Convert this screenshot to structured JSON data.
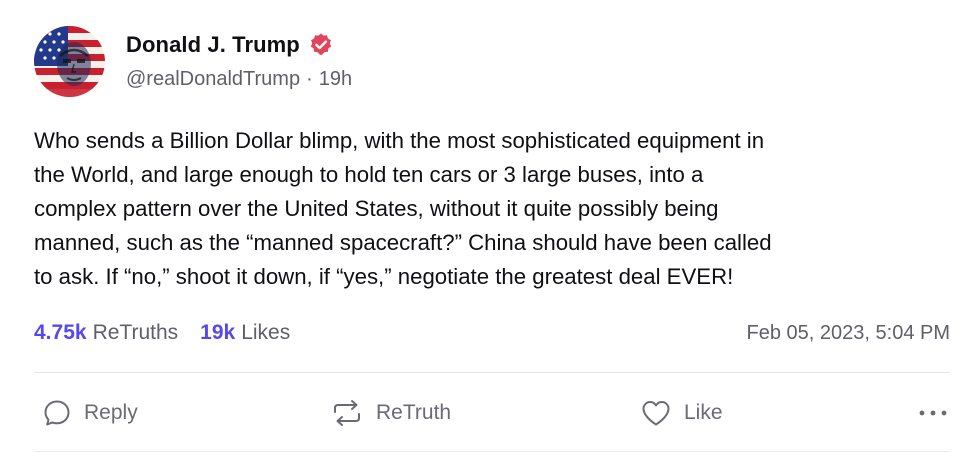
{
  "post": {
    "author": {
      "display_name": "Donald J. Trump",
      "handle": "@realDonaldTrump",
      "separator": "·",
      "time_ago": "19h",
      "verified": true,
      "avatar_icon": "flag-portrait-avatar"
    },
    "body_lines": [
      "Who sends a Billion Dollar blimp, with the most sophisticated equipment in",
      "the World, and large enough to hold ten cars or 3 large buses, into a",
      "complex pattern over the United States, without it quite possibly being",
      "manned, such as the “manned spacecraft?” China should have been called",
      "to ask. If “no,” shoot it down, if “yes,” negotiate the greatest deal EVER!"
    ],
    "stats": {
      "retruths_count": "4.75k",
      "retruths_label": "ReTruths",
      "likes_count": "19k",
      "likes_label": "Likes",
      "timestamp": "Feb 05, 2023, 5:04 PM"
    },
    "actions": {
      "reply_label": "Reply",
      "reply_icon": "speech-bubble-icon",
      "retruth_label": "ReTruth",
      "retruth_icon": "repost-arrows-icon",
      "like_label": "Like",
      "like_icon": "heart-icon",
      "more_icon": "ellipsis-icon"
    }
  },
  "colors": {
    "accent": "#5448ee",
    "verified_badge": "#e2445c",
    "muted_text": "#5f5f6b",
    "action_text": "#6a6a76",
    "divider": "#e4e4ea"
  }
}
